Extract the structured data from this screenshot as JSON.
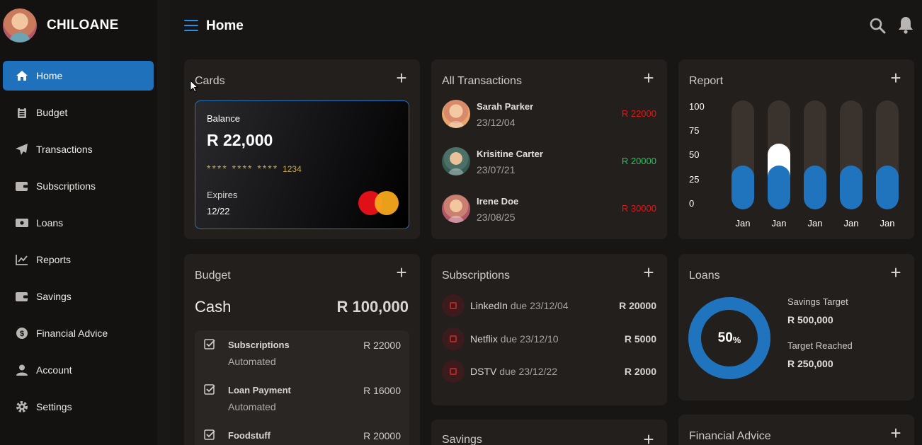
{
  "app": {
    "brand": "CHILOANE",
    "page_title": "Home"
  },
  "sidebar": {
    "items": [
      {
        "label": "Home",
        "icon": "home-icon",
        "active": true
      },
      {
        "label": "Budget",
        "icon": "clipboard-icon"
      },
      {
        "label": "Transactions",
        "icon": "paper-plane-icon"
      },
      {
        "label": "Subscriptions",
        "icon": "wallet-icon"
      },
      {
        "label": "Loans",
        "icon": "money-bill-icon"
      },
      {
        "label": "Reports",
        "icon": "chart-line-icon"
      },
      {
        "label": "Savings",
        "icon": "wallet-icon"
      },
      {
        "label": "Financial Advice",
        "icon": "dollar-coin-icon"
      },
      {
        "label": "Account",
        "icon": "user-icon"
      },
      {
        "label": "Settings",
        "icon": "gear-icon"
      }
    ]
  },
  "cards": {
    "title": "Cards",
    "card": {
      "balance_label": "Balance",
      "balance": "R 22,000",
      "number_masked": "**** **** **** ",
      "last4": "1234",
      "expires_label": "Expires",
      "expires": "12/22"
    }
  },
  "transactions": {
    "title": "All Transactions",
    "items": [
      {
        "name": "Sarah Parker",
        "date": "23/12/04",
        "amount": "R 22000",
        "type": "debit"
      },
      {
        "name": "Krisitine Carter",
        "date": "23/07/21",
        "amount": "R 20000",
        "type": "credit"
      },
      {
        "name": "Irene Doe",
        "date": "23/08/25",
        "amount": "R 30000",
        "type": "debit"
      }
    ]
  },
  "report": {
    "title": "Report",
    "y_ticks": [
      "100",
      "75",
      "50",
      "25",
      "0"
    ],
    "bars": [
      {
        "label": "Jan",
        "value": 40,
        "highlight": 0
      },
      {
        "label": "Jan",
        "value": 40,
        "highlight": 20
      },
      {
        "label": "Jan",
        "value": 40,
        "highlight": 0
      },
      {
        "label": "Jan",
        "value": 40,
        "highlight": 0
      },
      {
        "label": "Jan",
        "value": 40,
        "highlight": 0
      }
    ]
  },
  "budget": {
    "title": "Budget",
    "cash_label": "Cash",
    "cash_value": "R 100,000",
    "items": [
      {
        "name": "Subscriptions",
        "sub": "Automated",
        "amount": "R 22000"
      },
      {
        "name": "Loan Payment",
        "sub": "Automated",
        "amount": "R 16000"
      },
      {
        "name": "Foodstuff",
        "sub": "",
        "amount": "R 20000"
      }
    ]
  },
  "subscriptions": {
    "title": "Subscriptions",
    "items": [
      {
        "name": "LinkedIn",
        "due": "due 23/12/04",
        "amount": "R 20000"
      },
      {
        "name": "Netflix",
        "due": "due 23/12/10",
        "amount": "R 5000"
      },
      {
        "name": "DSTV",
        "due": "due 23/12/22",
        "amount": "R 2000"
      }
    ]
  },
  "loans": {
    "title": "Loans",
    "percent": "50",
    "percent_sign": "%",
    "progress": 0.5,
    "savings_target_label": "Savings Target",
    "savings_target": "R 500,000",
    "target_reached_label": "Target Reached",
    "target_reached": "R 250,000"
  },
  "savings": {
    "title": "Savings"
  },
  "financial_advice": {
    "title": "Financial Advice"
  },
  "colors": {
    "accent": "#2071bb",
    "debit": "#e01818",
    "credit": "#22c55e"
  }
}
